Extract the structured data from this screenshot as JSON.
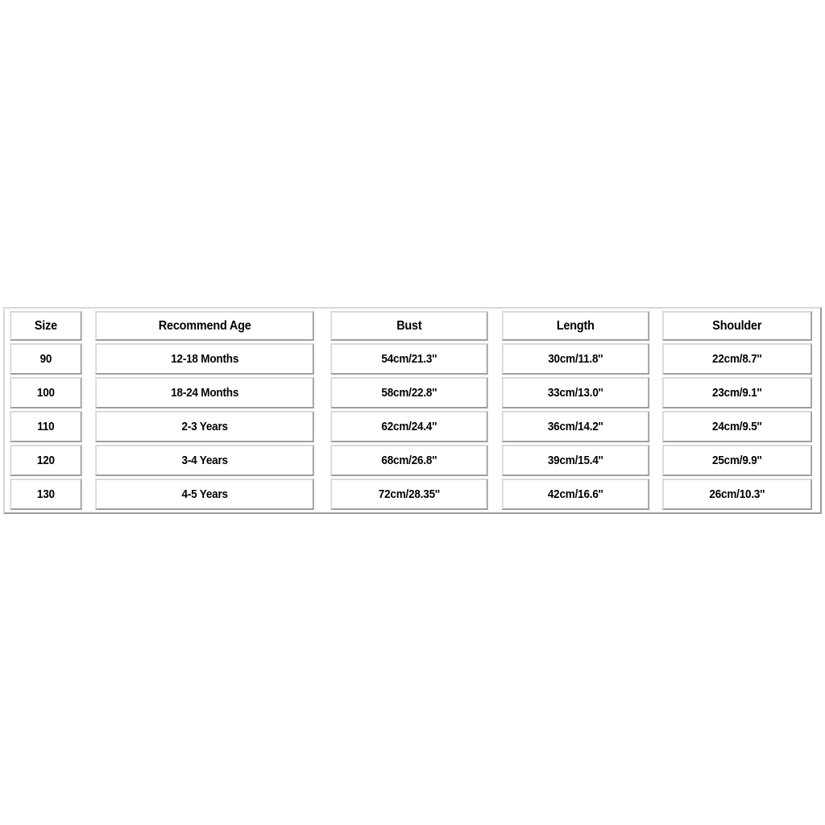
{
  "page": {
    "background_color": "#ffffff",
    "text_color": "#010101",
    "border_color": "#9e9e9e",
    "cell_background": "#ffffff"
  },
  "table": {
    "name": "size-chart",
    "columns": [
      {
        "key": "size",
        "label": "Size"
      },
      {
        "key": "age",
        "label": "Recommend Age"
      },
      {
        "key": "bust",
        "label": "Bust"
      },
      {
        "key": "length",
        "label": "Length"
      },
      {
        "key": "shoulder",
        "label": "Shoulder"
      }
    ],
    "rows": [
      {
        "size": "90",
        "age": "12-18 Months",
        "bust": "54cm/21.3''",
        "length": "30cm/11.8''",
        "shoulder": "22cm/8.7''"
      },
      {
        "size": "100",
        "age": "18-24 Months",
        "bust": "58cm/22.8''",
        "length": "33cm/13.0''",
        "shoulder": "23cm/9.1''"
      },
      {
        "size": "110",
        "age": "2-3 Years",
        "bust": "62cm/24.4''",
        "length": "36cm/14.2''",
        "shoulder": "24cm/9.5''"
      },
      {
        "size": "120",
        "age": "3-4 Years",
        "bust": "68cm/26.8''",
        "length": "39cm/15.4''",
        "shoulder": "25cm/9.9''"
      },
      {
        "size": "130",
        "age": "4-5 Years",
        "bust": "72cm/28.35''",
        "length": "42cm/16.6''",
        "shoulder": "26cm/10.3''"
      }
    ]
  },
  "chart_data": {
    "type": "table",
    "title": "",
    "columns": [
      "Size",
      "Recommend Age",
      "Bust",
      "Length",
      "Shoulder"
    ],
    "rows": [
      [
        "90",
        "12-18 Months",
        "54cm/21.3''",
        "30cm/11.8''",
        "22cm/8.7''"
      ],
      [
        "100",
        "18-24 Months",
        "58cm/22.8''",
        "33cm/13.0''",
        "23cm/9.1''"
      ],
      [
        "110",
        "2-3 Years",
        "62cm/24.4''",
        "36cm/14.2''",
        "24cm/9.5''"
      ],
      [
        "120",
        "3-4 Years",
        "68cm/26.8''",
        "39cm/15.4''",
        "25cm/9.9''"
      ],
      [
        "130",
        "4-5 Years",
        "72cm/28.35''",
        "42cm/16.6''",
        "26cm/10.3''"
      ]
    ],
    "units": {
      "bust": "cm / inches",
      "length": "cm / inches",
      "shoulder": "cm / inches"
    },
    "numeric": {
      "size": [
        90,
        100,
        110,
        120,
        130
      ],
      "bust_cm": [
        54,
        58,
        62,
        68,
        72
      ],
      "bust_in": [
        21.3,
        22.8,
        24.4,
        26.8,
        28.35
      ],
      "length_cm": [
        30,
        33,
        36,
        39,
        42
      ],
      "length_in": [
        11.8,
        13.0,
        14.2,
        15.4,
        16.6
      ],
      "shoulder_cm": [
        22,
        23,
        24,
        25,
        26
      ],
      "shoulder_in": [
        8.7,
        9.1,
        9.5,
        9.9,
        10.3
      ]
    }
  }
}
